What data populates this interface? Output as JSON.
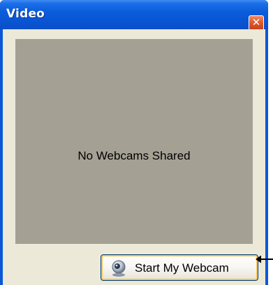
{
  "window": {
    "title": "Video",
    "close_glyph": "✕",
    "colors": {
      "titlebar": "#0a58d8",
      "client": "#ece9d8",
      "video_area": "#a5a094",
      "button_highlight": "#f7c459",
      "close_button": "#e05a2e"
    }
  },
  "video": {
    "status_text": "No Webcams Shared"
  },
  "webcam_button": {
    "label": "Start My Webcam",
    "icon": "webcam-icon"
  },
  "annotation": {
    "icon": "arrow-left-icon"
  }
}
